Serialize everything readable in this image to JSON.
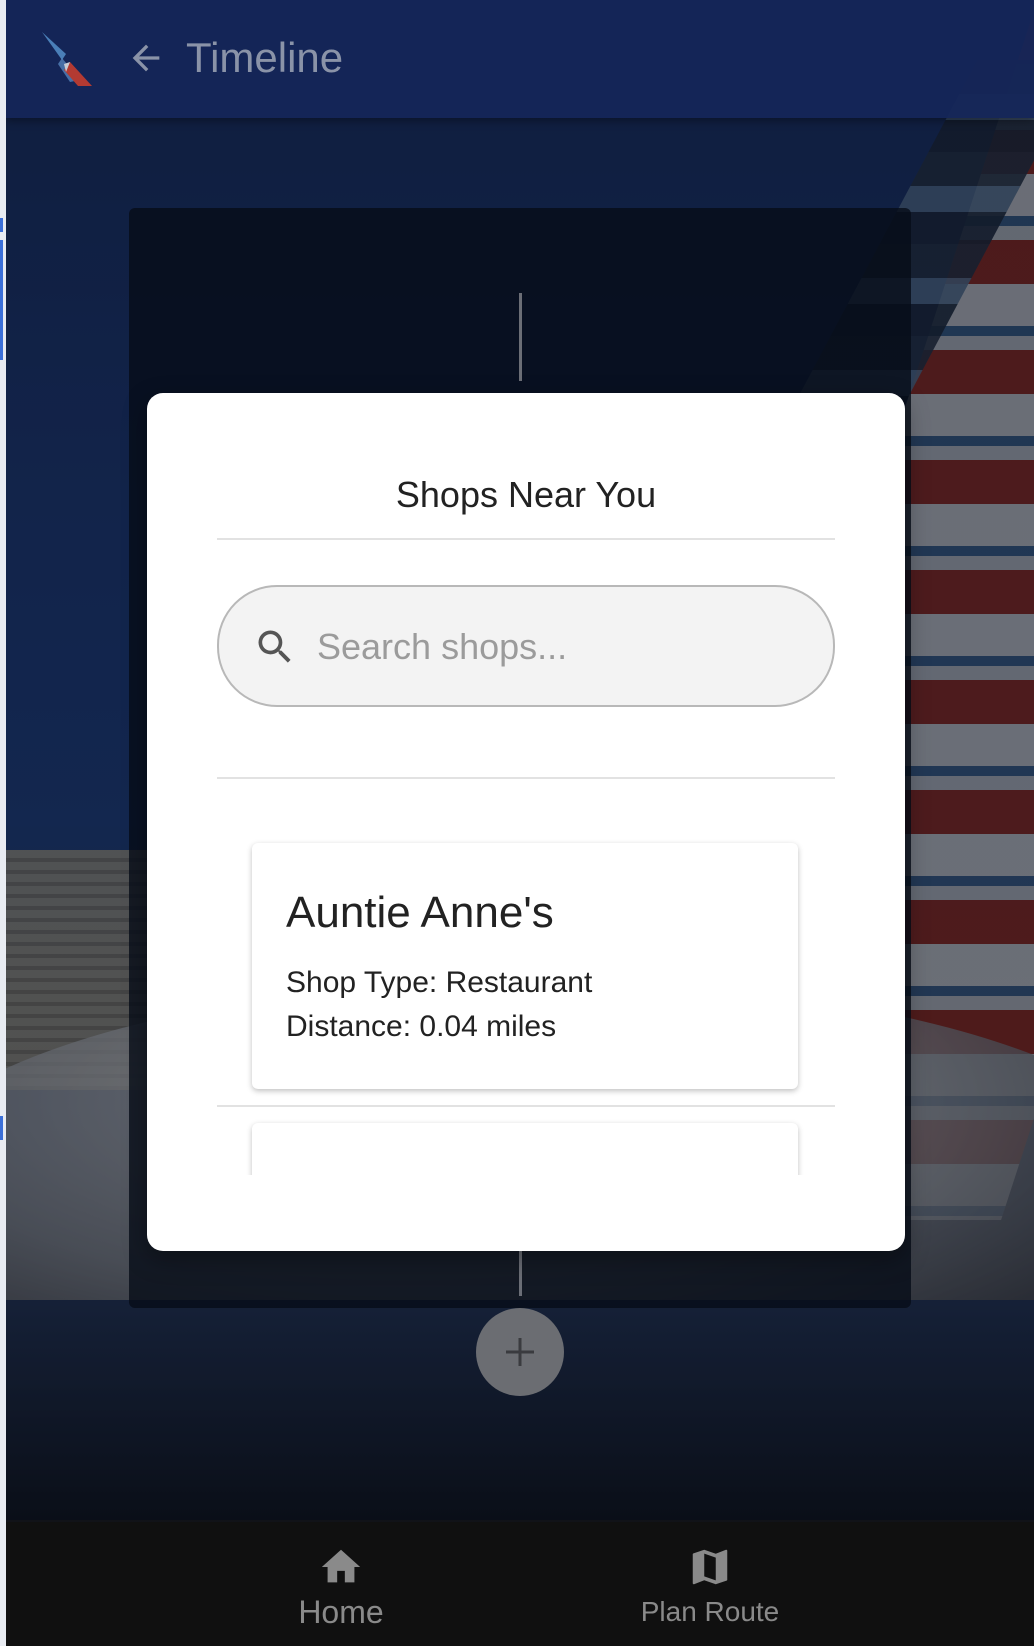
{
  "header": {
    "title": "Timeline",
    "logo_icon": "airline-tail-logo-icon",
    "back_icon": "arrow-back-icon"
  },
  "modal": {
    "title": "Shops Near You",
    "search": {
      "placeholder": "Search shops...",
      "value": "",
      "icon": "search-icon"
    },
    "shops": [
      {
        "name": "Auntie Anne's",
        "type": "Shop Type: Restaurant",
        "distance": "Distance: 0.04 miles"
      }
    ]
  },
  "timeline": {
    "add_icon": "plus-icon"
  },
  "bottom_nav": {
    "items": [
      {
        "label": "Home",
        "icon": "home-icon"
      },
      {
        "label": "Plan Route",
        "icon": "map-icon"
      }
    ]
  },
  "colors": {
    "topbar": "#152658",
    "title_text": "#8a93a8",
    "modal_bg": "#ffffff",
    "bottom_nav_bg": "#101010",
    "nav_label": "#8a8a8a",
    "add_button": "#6b6d72"
  }
}
